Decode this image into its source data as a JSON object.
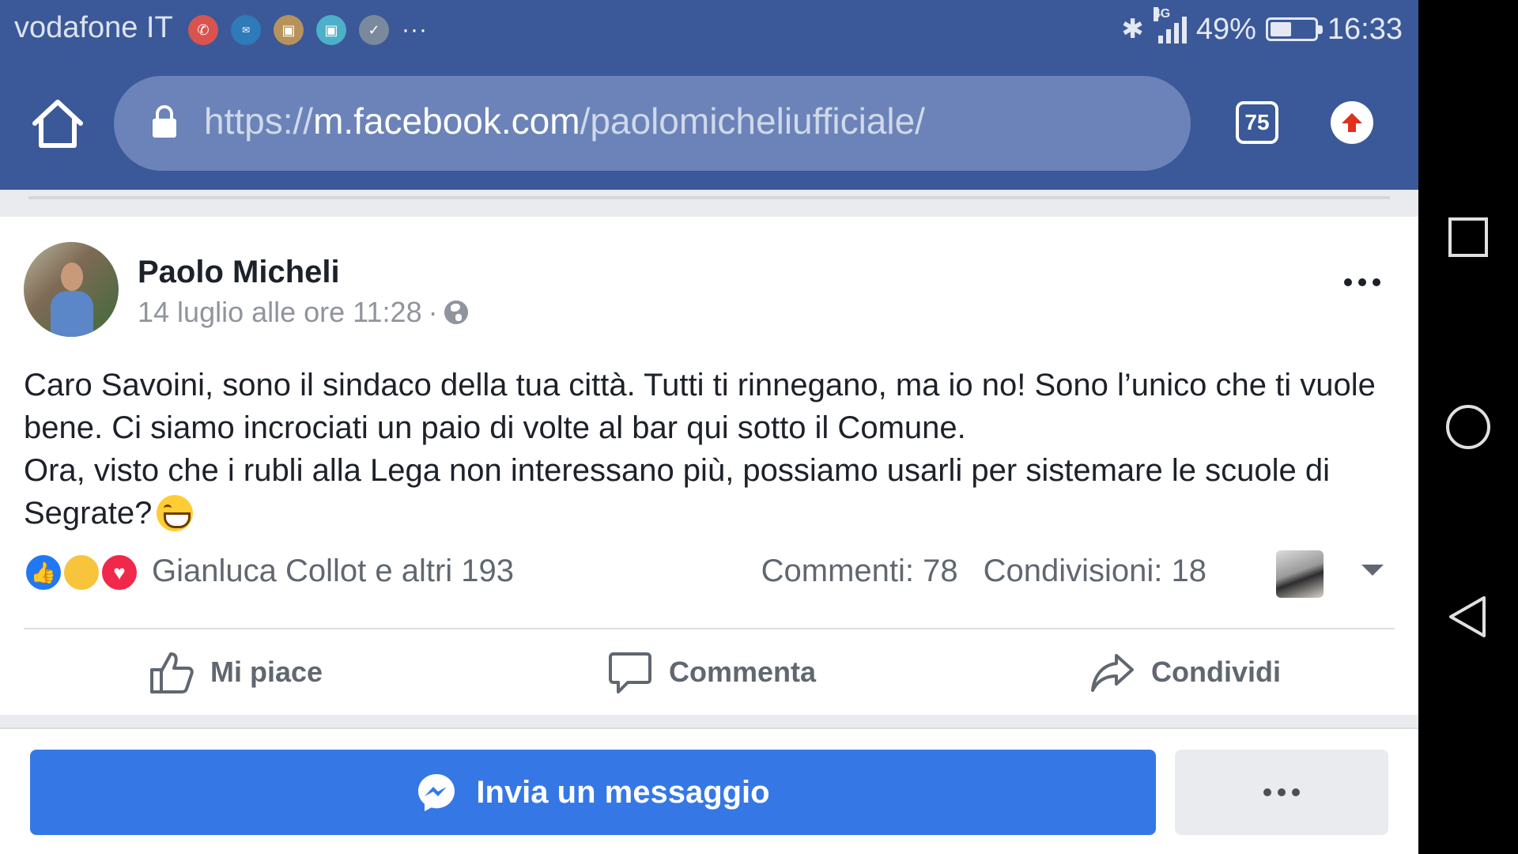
{
  "status_bar": {
    "carrier": "vodafone IT",
    "notifications": [
      "phone-icon",
      "mail-icon",
      "lock-icon",
      "image-icon",
      "check-icon"
    ],
    "more_glyph": "···",
    "network": "4G",
    "battery": "49%",
    "battery_level": 0.49,
    "time": "16:33"
  },
  "browser": {
    "url_scheme": "https://",
    "url_host": "m.facebook.com",
    "url_path": "/paolomicheliufficiale/",
    "tab_count": "75"
  },
  "post": {
    "author": "Paolo Micheli",
    "timestamp": "14 luglio alle ore 11:28",
    "meta_separator": "·",
    "text_lines": [
      "Caro Savoini, sono il sindaco della tua città. Tutti ti rinnegano, ma io no! Sono l’unico che ti vuole bene. Ci siamo incrociati un paio di volte al bar qui sotto il Comune.",
      "Ora, visto che i rubli alla Lega non interessano più, possiamo usarli per sistemare le scuole di Segrate?"
    ],
    "reactions_summary": "Gianluca Collot e altri 193",
    "comments": "Commenti: 78",
    "shares": "Condivisioni: 18",
    "actions": {
      "like": "Mi piace",
      "comment": "Commenta",
      "share": "Condividi"
    }
  },
  "page_actions": {
    "message_button": "Invia un messaggio"
  },
  "colors": {
    "facebook_blue": "#3b5998",
    "url_bar": "#6b83b8",
    "messenger_button": "#3578e5",
    "text_primary": "#1d2129",
    "text_secondary": "#616770"
  }
}
